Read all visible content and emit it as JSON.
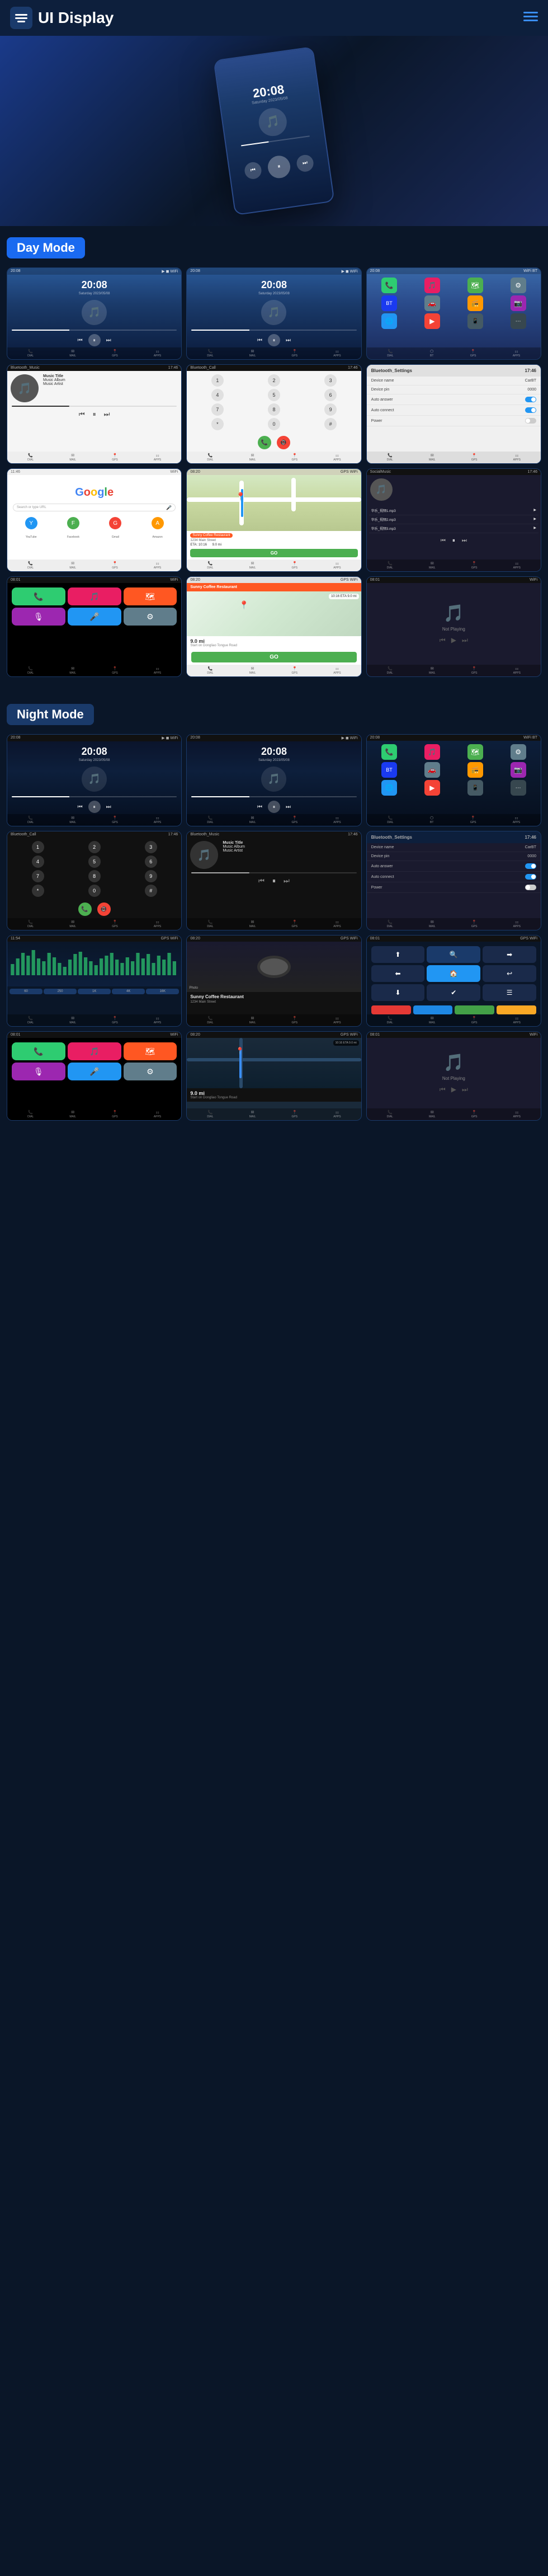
{
  "header": {
    "title": "UI Display",
    "menu_label": "≡"
  },
  "day_mode": {
    "label": "Day Mode"
  },
  "night_mode": {
    "label": "Night Mode"
  },
  "screens": {
    "music_title": "Music Title",
    "music_album": "Music Album",
    "music_artist": "Music Artist",
    "time": "20:08",
    "bluetooth_music": "Bluetooth_Music",
    "bluetooth_call": "Bluetooth_Call",
    "bluetooth_settings": "Bluetooth_Settings",
    "device_name_label": "Device name",
    "device_name_val": "CarBT",
    "device_pin_label": "Device pin",
    "device_pin_val": "0000",
    "auto_answer_label": "Auto answer",
    "auto_connect_label": "Auto connect",
    "power_label": "Power",
    "social_music_label": "SocialMusic",
    "google_label": "Google",
    "not_playing": "Not Playing",
    "sunny_coffee": "Sunny Coffee Restaurant",
    "sunny_address": "1234 Main Street",
    "eta_label": "ETA",
    "eta_val": "10:16",
    "distance_label": "9.0 mi",
    "go_btn": "GO",
    "start_label": "Start on Dongliao Tongue Road",
    "dialpad_nums": [
      "1",
      "2",
      "3",
      "4",
      "5",
      "6",
      "7",
      "8",
      "9",
      "*",
      "0",
      "#"
    ]
  }
}
